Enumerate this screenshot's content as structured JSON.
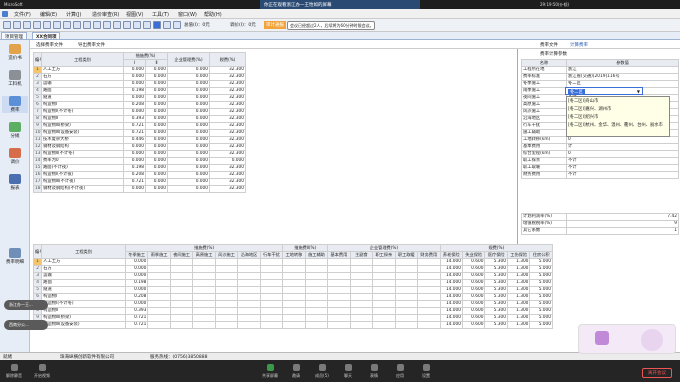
{
  "system": {
    "left_label": "MicroSoft",
    "right_time": "29:19:50(仆倾)",
    "meeting_btn": "退出会议",
    "window_title": "你正在观看浙江办一王怡如的屏幕"
  },
  "meeting": {
    "text": "正在讲话：浙江办一王怡如"
  },
  "menu": [
    "文件(F)",
    "编辑(E)",
    "计算(J)",
    "造价审查(R)",
    "视图(V)",
    "工具(T)",
    "窗口(W)",
    "帮助(H)"
  ],
  "toolbar": {
    "total_label": "总值(Ⅰ)：0元",
    "adjust_label": "调价(Ⅰ)：0元",
    "audit_label": "审计通报",
    "notice": "会议已经超过2人，后续将为60分钟时限会议。"
  },
  "tabs": {
    "project": "项目管理",
    "current": "XX合同项"
  },
  "sidebar": [
    "造价书",
    "工料机",
    "费率",
    "分摊",
    "调价",
    "报表",
    "费率明细"
  ],
  "subtabs": {
    "left1": "选择费率文件",
    "left2": "导出费率文件",
    "right1": "费率文件",
    "right2": "计算费率"
  },
  "upper_table": {
    "headers": {
      "code": "编号",
      "name": "工程类别",
      "winter": "措施费(%)",
      "c1": "Ⅰ",
      "c2": "Ⅱ",
      "mgmt": "企业管理费(%)",
      "tax": "税费(%)"
    },
    "rows": [
      {
        "n": "1",
        "name": "人工土方",
        "v1": "0.000",
        "v2": "0.000",
        "v3": "0.000",
        "v4": "32.300"
      },
      {
        "n": "2",
        "name": "石方",
        "v1": "0.000",
        "v2": "0.000",
        "v3": "0.000",
        "v4": "32.300"
      },
      {
        "n": "3",
        "name": "运输",
        "v1": "0.000",
        "v2": "0.000",
        "v3": "0.000",
        "v4": "32.300"
      },
      {
        "n": "4",
        "name": "路面",
        "v1": "0.198",
        "v2": "0.000",
        "v3": "0.000",
        "v4": "32.300"
      },
      {
        "n": "5",
        "name": "隧道",
        "v1": "0.000",
        "v2": "0.000",
        "v3": "0.000",
        "v4": "32.300"
      },
      {
        "n": "6",
        "name": "构造物Ⅰ",
        "v1": "0.208",
        "v2": "0.000",
        "v3": "0.000",
        "v4": "32.300"
      },
      {
        "n": "7",
        "name": "构造物Ⅰ(不计冬)",
        "v1": "0.000",
        "v2": "0.000",
        "v3": "0.000",
        "v4": "32.300"
      },
      {
        "n": "8",
        "name": "构造物Ⅱ",
        "v1": "0.393",
        "v2": "0.000",
        "v3": "0.000",
        "v4": "32.300"
      },
      {
        "n": "9",
        "name": "构造物Ⅲ(桥梁)",
        "v1": "0.721",
        "v2": "0.000",
        "v3": "0.000",
        "v4": "32.300"
      },
      {
        "n": "10",
        "name": "构造物Ⅲ(设备安装)",
        "v1": "0.721",
        "v2": "0.000",
        "v3": "0.000",
        "v4": "32.300"
      },
      {
        "n": "11",
        "name": "技术复杂大桥",
        "v1": "0.446",
        "v2": "0.000",
        "v3": "0.000",
        "v4": "32.300"
      },
      {
        "n": "12",
        "name": "钢材及钢结构",
        "v1": "0.000",
        "v2": "0.000",
        "v3": "0.000",
        "v4": "32.300"
      },
      {
        "n": "13",
        "name": "构造物Ⅱ(不计冬)",
        "v1": "0.000",
        "v2": "0.000",
        "v3": "0.000",
        "v4": "32.300"
      },
      {
        "n": "14",
        "name": "费率为0",
        "v1": "0.000",
        "v2": "0.000",
        "v3": "0.000",
        "v4": "0.000"
      },
      {
        "n": "15",
        "name": "路面(不计夜)",
        "v1": "0.198",
        "v2": "0.000",
        "v3": "0.000",
        "v4": "32.300"
      },
      {
        "n": "16",
        "name": "构造物Ⅰ(不计夜)",
        "v1": "0.208",
        "v2": "0.000",
        "v3": "0.000",
        "v4": "32.300"
      },
      {
        "n": "17",
        "name": "构造物Ⅲ(不计夜)",
        "v1": "0.721",
        "v2": "0.000",
        "v3": "0.000",
        "v4": "32.300"
      },
      {
        "n": "18",
        "name": "钢材及钢结构(不计夜)",
        "v1": "0.000",
        "v2": "0.000",
        "v3": "0.000",
        "v4": "32.300"
      }
    ]
  },
  "right_panel": {
    "title": "费率计算参数",
    "col_name": "名称",
    "col_value": "参数值",
    "params": [
      {
        "k": "工程所在地",
        "v": "浙江"
      },
      {
        "k": "费率标准",
        "v": "浙江省(交通)[2019]116号"
      },
      {
        "k": "冬季施工",
        "v": "冬二区"
      },
      {
        "k": "雨季施工",
        "v": "不计"
      },
      {
        "k": "夜间施工",
        "v": "不计"
      },
      {
        "k": "高原施工",
        "v": ""
      },
      {
        "k": "风沙施工",
        "v": ""
      },
      {
        "k": "沿海地区",
        "v": ""
      },
      {
        "k": "行车干扰",
        "v": "不计"
      },
      {
        "k": "施工辅助",
        "v": "不计"
      },
      {
        "k": "工地转移(km)",
        "v": "0"
      },
      {
        "k": "基本费用",
        "v": "计"
      },
      {
        "k": "综合里程(km)",
        "v": "0"
      },
      {
        "k": "职工探亲",
        "v": "不计"
      },
      {
        "k": "职工取暖",
        "v": "不计"
      },
      {
        "k": "财务费用",
        "v": "不计"
      }
    ],
    "popup": [
      "[冬二区Ⅰ]舟山市",
      "[冬二区Ⅰ]嘉兴、湖州市",
      "[冬二区Ⅰ]绍兴市",
      "[冬二区Ⅰ]杭州、金华、温州、衢州、台州、丽水市"
    ],
    "bottom": [
      {
        "k": "计划利润率(%)",
        "v": "7.42"
      },
      {
        "k": "增值税税率(%)",
        "v": "9"
      },
      {
        "k": "其它系数",
        "v": "1"
      }
    ]
  },
  "lower_table": {
    "groups": {
      "g1": "措施费(%)",
      "g2": "措施费Ⅱ(%)",
      "g3": "企业管理费(%)",
      "g4": "规费(%)"
    },
    "cols": [
      "冬季施工",
      "雨季施工",
      "夜间施工",
      "高原施工",
      "风沙施工",
      "沿海地区",
      "行车干扰",
      "工地转移",
      "施工辅助",
      "基本费用",
      "主副食",
      "职工探亲",
      "职工取暖",
      "财务费用",
      "养老保险",
      "失业保险",
      "医疗保险",
      "工伤保险",
      "住房公积"
    ],
    "rows": [
      {
        "n": "1",
        "name": "人工土方",
        "a": "0.000",
        "e": "14.000",
        "f": "0.600",
        "g": "5.300",
        "h": "1.300",
        "i": "5.000"
      },
      {
        "n": "2",
        "name": "石方",
        "a": "0.000",
        "e": "14.000",
        "f": "0.600",
        "g": "5.300",
        "h": "1.300",
        "i": "5.000"
      },
      {
        "n": "3",
        "name": "运输",
        "a": "0.000",
        "e": "14.000",
        "f": "0.600",
        "g": "5.300",
        "h": "1.300",
        "i": "5.000"
      },
      {
        "n": "4",
        "name": "路面",
        "a": "0.198",
        "e": "14.000",
        "f": "0.600",
        "g": "5.300",
        "h": "1.300",
        "i": "5.000"
      },
      {
        "n": "5",
        "name": "隧道",
        "a": "0.000",
        "e": "14.000",
        "f": "0.600",
        "g": "5.300",
        "h": "1.300",
        "i": "5.000"
      },
      {
        "n": "6",
        "name": "构造物Ⅰ",
        "a": "0.208",
        "e": "14.000",
        "f": "0.600",
        "g": "5.300",
        "h": "1.300",
        "i": "5.000"
      },
      {
        "n": "7",
        "name": "构造物Ⅰ(不计冬)",
        "a": "0.000",
        "e": "14.000",
        "f": "0.600",
        "g": "5.300",
        "h": "1.300",
        "i": "5.000"
      },
      {
        "n": "8",
        "name": "构造物Ⅱ",
        "a": "0.393",
        "e": "14.000",
        "f": "0.600",
        "g": "5.300",
        "h": "1.300",
        "i": "5.000"
      },
      {
        "n": "9",
        "name": "构造物Ⅲ(桥梁)",
        "a": "0.721",
        "e": "14.000",
        "f": "0.600",
        "g": "5.300",
        "h": "1.300",
        "i": "5.000"
      },
      {
        "n": "10",
        "name": "构造物Ⅲ(设备安装)",
        "a": "0.721",
        "e": "14.000",
        "f": "0.600",
        "g": "5.300",
        "h": "1.300",
        "i": "5.000"
      }
    ]
  },
  "status": {
    "ready": "就绪",
    "company": "珠海纵横创新软件有限公司",
    "hotline": "服务热线：(0756)3850888"
  },
  "pills": [
    "浙江办一王...",
    "西南分公..."
  ],
  "taskbar": {
    "left1": "解除静音",
    "left2": "开启视频",
    "items": [
      "共享屏幕",
      "邀请",
      "成员(5)",
      "聊天",
      "表情",
      "应用",
      "设置"
    ],
    "leave": "离开会议"
  }
}
